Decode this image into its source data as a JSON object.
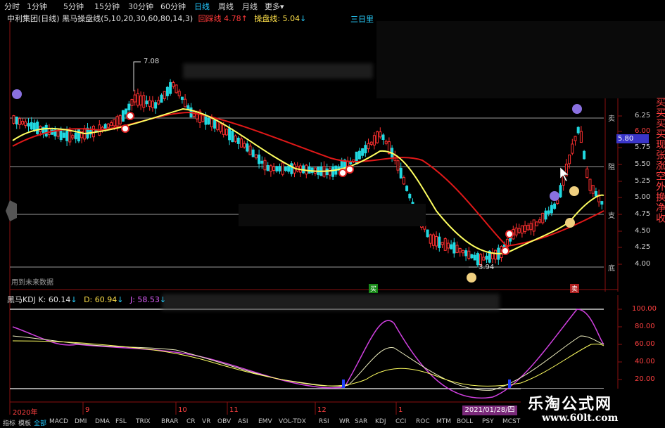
{
  "topbar": {
    "tabs": [
      "分时",
      "1分钟",
      "5分钟",
      "15分钟",
      "30分钟",
      "60分钟",
      "日线",
      "周线",
      "月线",
      "更多"
    ],
    "active": "日线"
  },
  "title": {
    "stock": "中利集团(日线)",
    "indicator": "黑马操盘线(5,10,20,30,60,80,14,3)",
    "red_label": "回踩线",
    "red_value": "4.78",
    "yellow_label": "操盘线:",
    "yellow_value": "5.04",
    "right_label": "三日里"
  },
  "price_axis": [
    "6.25",
    "6.00",
    "5.75",
    "5.50",
    "5.25",
    "5.00",
    "4.75",
    "4.50",
    "4.25",
    "4.00"
  ],
  "current_price": "5.80",
  "annotations": {
    "high": "7.08",
    "low": "3.94",
    "note": "用到未来数据",
    "level_top": "卖",
    "level_resist": "阻",
    "level_support": "支",
    "level_bottom": "底",
    "buy_tag": "买",
    "sell_tag": "卖"
  },
  "side_text": "买买买买现张涨空外换净收",
  "kdj": {
    "name": "黑马KDJ",
    "k": "K: 60.14",
    "d": "D: 60.94",
    "j": "J: 58.53",
    "axis": [
      "100.00",
      "80.00",
      "60.00",
      "40.00",
      "20.00"
    ]
  },
  "x_axis": [
    "2020年",
    "9",
    "10",
    "11",
    "12",
    "1"
  ],
  "date_box": "2021/01/28/四",
  "bottom_tabs": [
    "指标",
    "模板",
    "全部",
    "MACD",
    "DMI",
    "DMA",
    "FSL",
    "TRIX",
    "BRAR",
    "CR",
    "VR",
    "OBV",
    "ASI",
    "EMV",
    "VOL-TDX",
    "RSI",
    "WR",
    "SAR",
    "KDJ",
    "CCI",
    "ROC",
    "MTM",
    "BOLL",
    "PSY",
    "MCST"
  ],
  "brand": {
    "name": "乐淘公式网",
    "url": "www.60lt.com"
  },
  "colors": {
    "up": "#ff3030",
    "down": "#20d8e0",
    "yellow_line": "#ffff60",
    "red_line": "#e01818",
    "j_line": "#d040e0"
  }
}
